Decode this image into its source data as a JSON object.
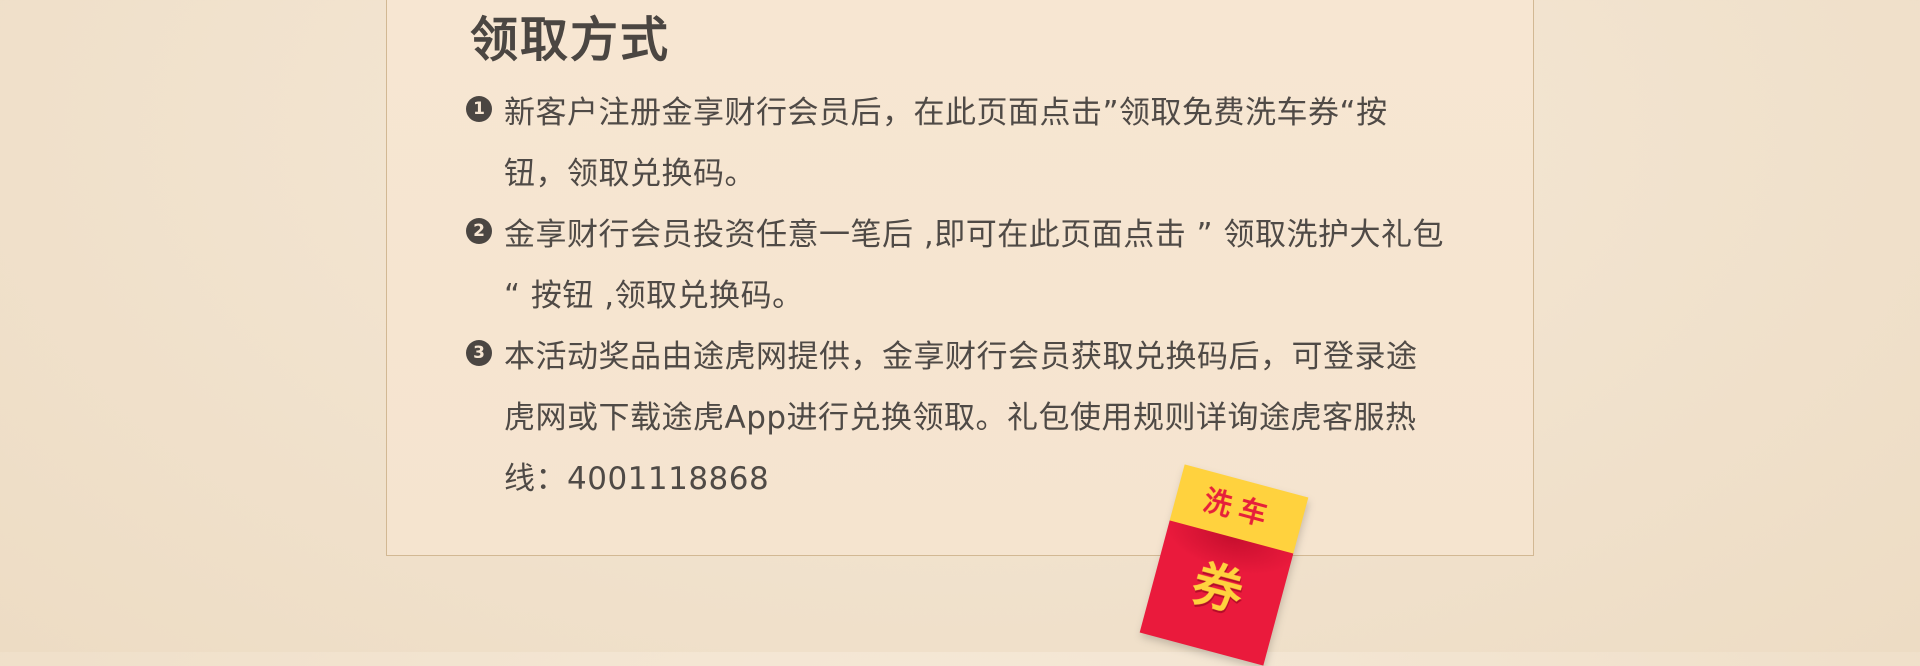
{
  "title": "领取方式",
  "items": [
    {
      "number": "1",
      "text": "新客户注册金享财行会员后，在此页面点击”领取免费洗车券“按钮，领取兑换码。"
    },
    {
      "number": "2",
      "text": "金享财行会员投资任意一笔后 ,即可在此页面点击 ” 领取洗护大礼包 “ 按钮 ,领取兑换码。"
    },
    {
      "number": "3",
      "text": "本活动奖品由途虎网提供，金享财行会员获取兑换码后，可登录途虎网或下载途虎App进行兑换领取。礼包使用规则详询途虎客服热线：4001118868"
    }
  ],
  "badge": {
    "top_text": "洗车",
    "main_text": "券"
  },
  "colors": {
    "background": "#f1e2cd",
    "panel": "#f6e5d0",
    "text": "#4f4a46",
    "badge_yellow": "#ffd23e",
    "badge_red": "#ea1a3c"
  }
}
